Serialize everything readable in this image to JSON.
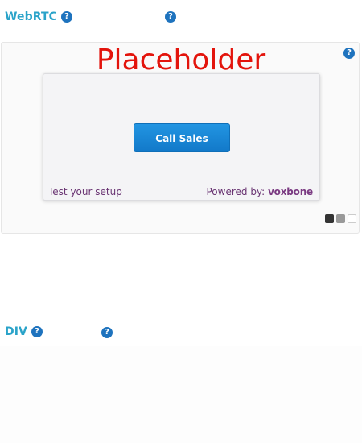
{
  "sections": {
    "webrtc": {
      "title": "WebRTC",
      "help_glyph": "?",
      "help2_glyph": "?"
    },
    "div": {
      "title": "DIV",
      "help_glyph": "?",
      "help2_glyph": "?"
    }
  },
  "preview": {
    "placeholder_text": "Placeholder",
    "help_glyph": "?",
    "widget": {
      "call_button_label": "Call Sales",
      "test_setup_label": "Test your setup",
      "powered_by_label": "Powered by:",
      "brand_name": "voxbone"
    },
    "swatches": [
      {
        "name": "dark",
        "color": "#333333"
      },
      {
        "name": "gray",
        "color": "#999999"
      },
      {
        "name": "white",
        "color": "#ffffff"
      }
    ]
  },
  "colors": {
    "section_title": "#2aa3c9",
    "help_icon": "#1e73be",
    "placeholder": "#e3140c",
    "button": "#1a86d6",
    "link": "#6a3573"
  },
  "icons": {
    "help": "question-circle-icon"
  }
}
